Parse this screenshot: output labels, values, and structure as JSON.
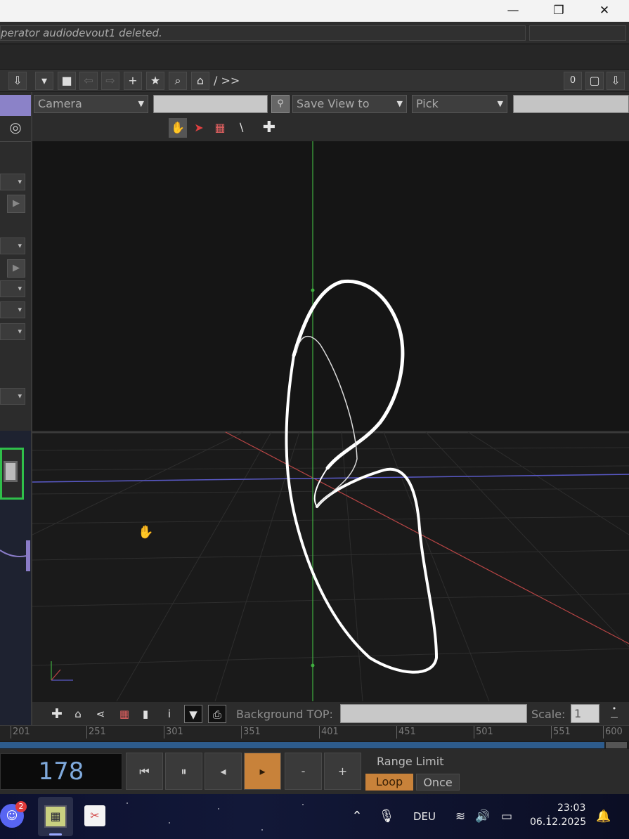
{
  "window": {
    "minimize_glyph": "—",
    "maximize_glyph": "❐",
    "close_glyph": "✕"
  },
  "status": {
    "message": "perator audiodevout1 deleted."
  },
  "toolbar": {
    "path": "/ >>",
    "count": "0"
  },
  "viewer": {
    "camera_dropdown": "Camera",
    "save_view_dropdown": "Save View to",
    "pick_dropdown": "Pick",
    "background_top_label": "Background TOP:",
    "background_top_value": "",
    "scale_label": "Scale:",
    "scale_value": "1"
  },
  "timeline": {
    "ticks": [
      "201",
      "251",
      "301",
      "351",
      "401",
      "451",
      "501",
      "551",
      "600"
    ]
  },
  "transport": {
    "current_frame": "178",
    "range_limit_label": "Range Limit",
    "loop_label": "Loop",
    "once_label": "Once",
    "minus_label": "-",
    "plus_label": "+"
  },
  "taskbar": {
    "discord_badge": "2",
    "language": "DEU",
    "time": "23:03",
    "date": "06.12.2025"
  },
  "colors": {
    "accent_orange": "#c8823a",
    "frame_blue": "#7fa9dc",
    "timeline_blue": "#2d5b8c",
    "axis_green": "#3fae3f",
    "axis_red": "#b84545",
    "axis_blue": "#5a5ac8"
  }
}
